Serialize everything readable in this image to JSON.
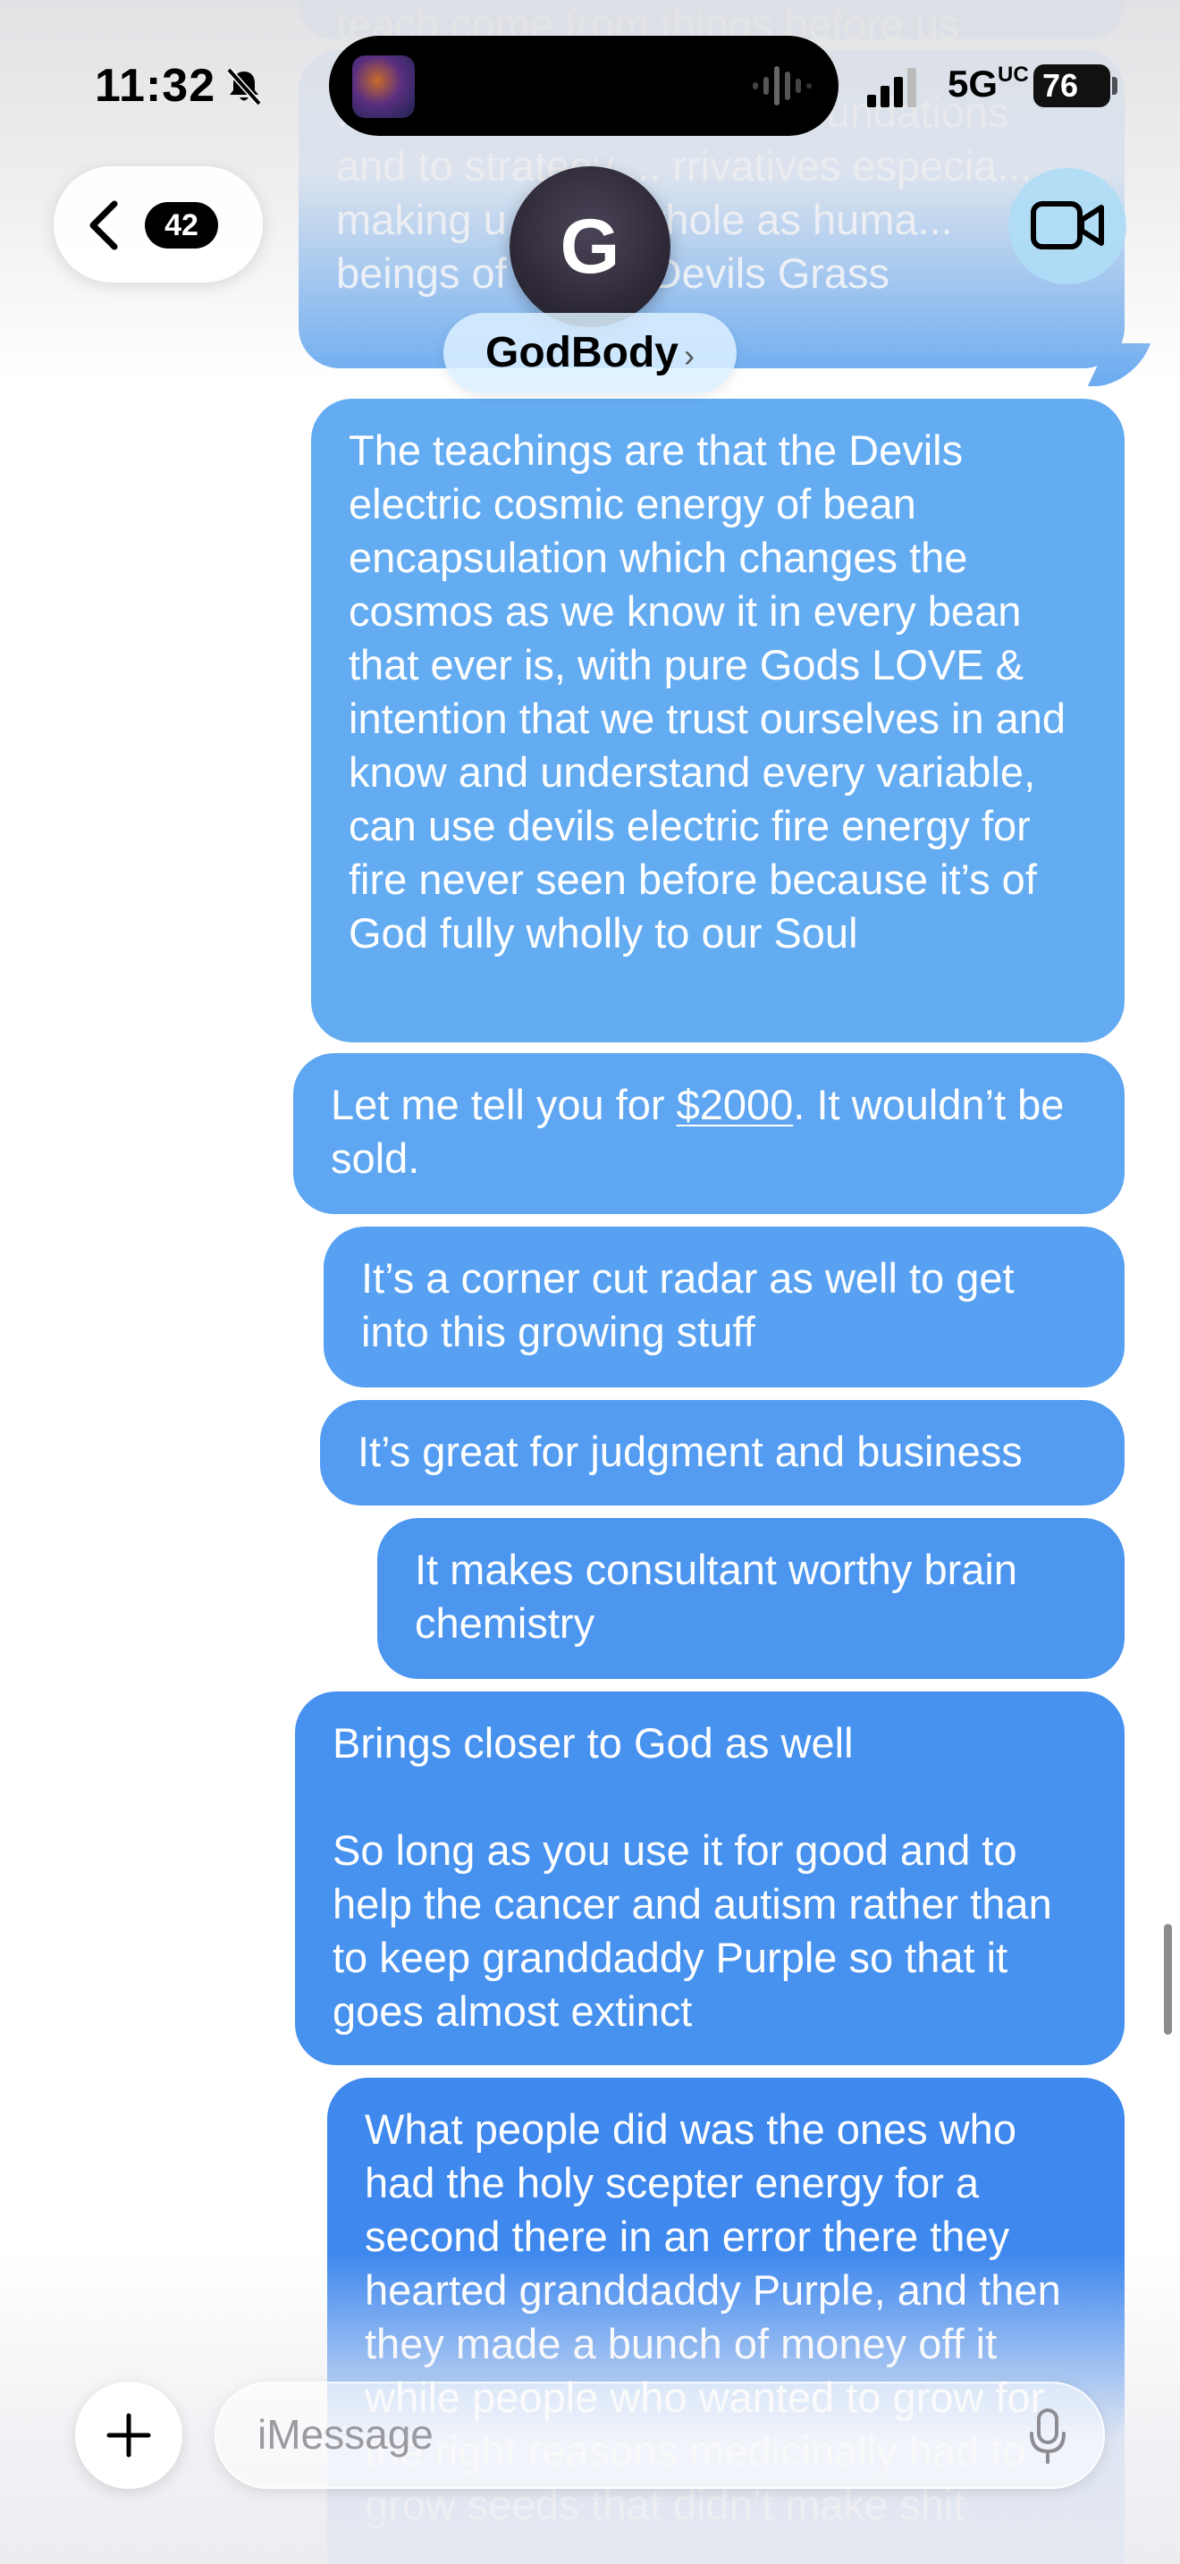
{
  "status_bar": {
    "time": "11:32",
    "network": "5G",
    "network_suffix": "UC",
    "battery": "76"
  },
  "nav": {
    "unread_count": "42",
    "avatar_initial": "G",
    "contact_name": "GodBody",
    "contact_chevron": "›"
  },
  "messages": [
    {
      "text": "teach come from things before us"
    },
    {
      "text": "...ise to variables and to foundations and to strategy ... rrivatives especia... making u... and whole as huma... beings of ... with Devils Grass"
    },
    {
      "text": "The teachings are that the Devils electric cosmic energy of bean encapsulation which changes the cosmos as we know it in every bean that ever is, with pure Gods LOVE & intention that we trust ourselves in and know and understand every variable, can use devils electric fire energy for fire never seen before because it’s of God fully wholly to our Soul"
    },
    {
      "before": "Let me tell you for ",
      "link": "$2000",
      "after": ". It wouldn’t be sold."
    },
    {
      "text": "It’s a corner cut radar as well to get into this growing stuff"
    },
    {
      "text": "It’s great for judgment and business"
    },
    {
      "text": "It makes consultant worthy brain chemistry"
    },
    {
      "text": "Brings closer to God as well\n\nSo long as you use it for good and to help the cancer and autism rather than to keep granddaddy Purple so that it goes almost extinct"
    },
    {
      "text": "What people did was the ones who had the holy scepter energy for a second there in an error there they hearted granddaddy Purple, and then they made a bunch of money off it while people who wanted to grow for the right reasons medicinally had to grow seeds that didn’t make shit"
    }
  ],
  "compose": {
    "placeholder": "iMessage"
  },
  "icons": {
    "bell": "bell-slash-icon",
    "back": "chevron-left-icon",
    "video": "video-camera-icon",
    "plus": "plus-icon",
    "mic": "microphone-icon"
  },
  "colors": {
    "bubble_blue": "#4a93ef",
    "bubble_blue_light": "#6cabf0"
  }
}
